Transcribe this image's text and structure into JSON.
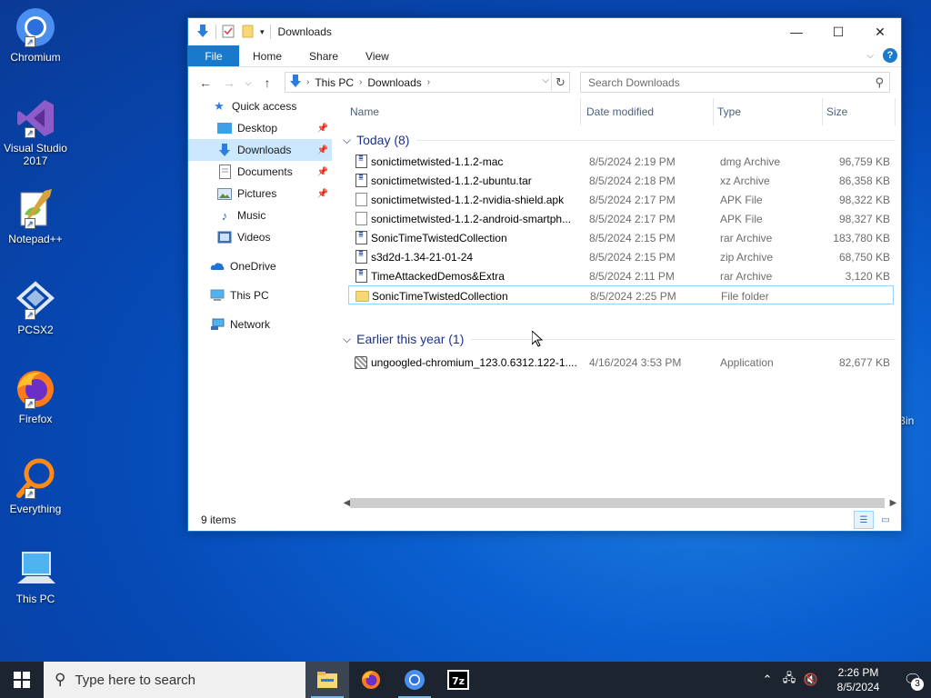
{
  "desktop": {
    "icons": [
      {
        "label": "Chromium"
      },
      {
        "label": "Visual Studio 2017"
      },
      {
        "label": "Notepad++"
      },
      {
        "label": "PCSX2"
      },
      {
        "label": "Firefox"
      },
      {
        "label": "Everything"
      },
      {
        "label": "This PC"
      }
    ],
    "partial_label": "Bin"
  },
  "window": {
    "title": "Downloads",
    "tabs": [
      "File",
      "Home",
      "Share",
      "View"
    ],
    "controls": {
      "minimize": "—",
      "maximize": "☐",
      "close": "✕"
    },
    "address": {
      "segments": [
        "This PC",
        "Downloads"
      ]
    },
    "search_placeholder": "Search Downloads",
    "nav": {
      "quick_access": "Quick access",
      "desktop": "Desktop",
      "downloads": "Downloads",
      "documents": "Documents",
      "pictures": "Pictures",
      "music": "Music",
      "videos": "Videos",
      "onedrive": "OneDrive",
      "this_pc": "This PC",
      "network": "Network"
    },
    "columns": {
      "name": "Name",
      "date": "Date modified",
      "type": "Type",
      "size": "Size"
    },
    "groups": [
      {
        "title": "Today (8)",
        "files": [
          {
            "name": "sonictimetwisted-1.1.2-mac",
            "date": "8/5/2024 2:19 PM",
            "type": "dmg Archive",
            "size": "96,759 KB",
            "icon": "archive-icon"
          },
          {
            "name": "sonictimetwisted-1.1.2-ubuntu.tar",
            "date": "8/5/2024 2:18 PM",
            "type": "xz Archive",
            "size": "86,358 KB",
            "icon": "archive-icon"
          },
          {
            "name": "sonictimetwisted-1.1.2-nvidia-shield.apk",
            "date": "8/5/2024 2:17 PM",
            "type": "APK File",
            "size": "98,322 KB",
            "icon": "file-icon"
          },
          {
            "name": "sonictimetwisted-1.1.2-android-smartph...",
            "date": "8/5/2024 2:17 PM",
            "type": "APK File",
            "size": "98,327 KB",
            "icon": "file-icon"
          },
          {
            "name": "SonicTimeTwistedCollection",
            "date": "8/5/2024 2:15 PM",
            "type": "rar Archive",
            "size": "183,780 KB",
            "icon": "archive-icon"
          },
          {
            "name": "s3d2d-1.34-21-01-24",
            "date": "8/5/2024 2:15 PM",
            "type": "zip Archive",
            "size": "68,750 KB",
            "icon": "archive-icon"
          },
          {
            "name": "TimeAttackedDemos&Extra",
            "date": "8/5/2024 2:11 PM",
            "type": "rar Archive",
            "size": "3,120 KB",
            "icon": "archive-icon"
          },
          {
            "name": "SonicTimeTwistedCollection",
            "date": "8/5/2024 2:25 PM",
            "type": "File folder",
            "size": "",
            "icon": "folder-icon"
          }
        ]
      },
      {
        "title": "Earlier this year (1)",
        "files": [
          {
            "name": "ungoogled-chromium_123.0.6312.122-1....",
            "date": "4/16/2024 3:53 PM",
            "type": "Application",
            "size": "82,677 KB",
            "icon": "application-icon"
          }
        ]
      }
    ],
    "status": "9 items"
  },
  "taskbar": {
    "search_placeholder": "Type here to search",
    "time": "2:26 PM",
    "date": "8/5/2024",
    "notification_count": "3"
  },
  "colors": {
    "accent": "#1979ca",
    "taskbar": "#1c2430",
    "selection": "#cce8ff"
  }
}
